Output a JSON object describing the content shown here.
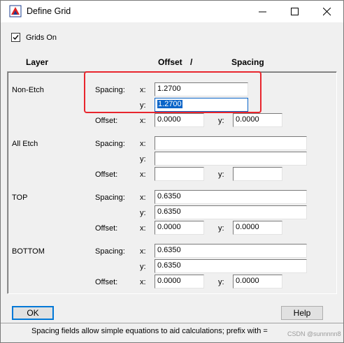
{
  "window": {
    "title": "Define Grid"
  },
  "grids_on": {
    "label": "Grids On",
    "checked": true
  },
  "headers": {
    "layer": "Layer",
    "offset": "Offset",
    "slash": "/",
    "spacing": "Spacing"
  },
  "field_labels": {
    "spacing": "Spacing:",
    "offset": "Offset:",
    "x": "x:",
    "y": "y:"
  },
  "layers": [
    {
      "name": "Non-Etch",
      "spacing_x": "1.2700",
      "spacing_y": "1.2700",
      "offset_x": "0.0000",
      "offset_y": "0.0000"
    },
    {
      "name": "All Etch",
      "spacing_x": "",
      "spacing_y": "",
      "offset_x": "",
      "offset_y": ""
    },
    {
      "name": "TOP",
      "spacing_x": "0.6350",
      "spacing_y": "0.6350",
      "offset_x": "0.0000",
      "offset_y": "0.0000"
    },
    {
      "name": "BOTTOM",
      "spacing_x": "0.6350",
      "spacing_y": "0.6350",
      "offset_x": "0.0000",
      "offset_y": "0.0000"
    }
  ],
  "buttons": {
    "ok": "OK",
    "help": "Help"
  },
  "status": "Spacing fields allow simple equations to aid calculations; prefix with =",
  "watermark": "CSDN @sunnnnn8",
  "colors": {
    "highlight": "#0a64c8",
    "annotation": "#e8252d"
  }
}
